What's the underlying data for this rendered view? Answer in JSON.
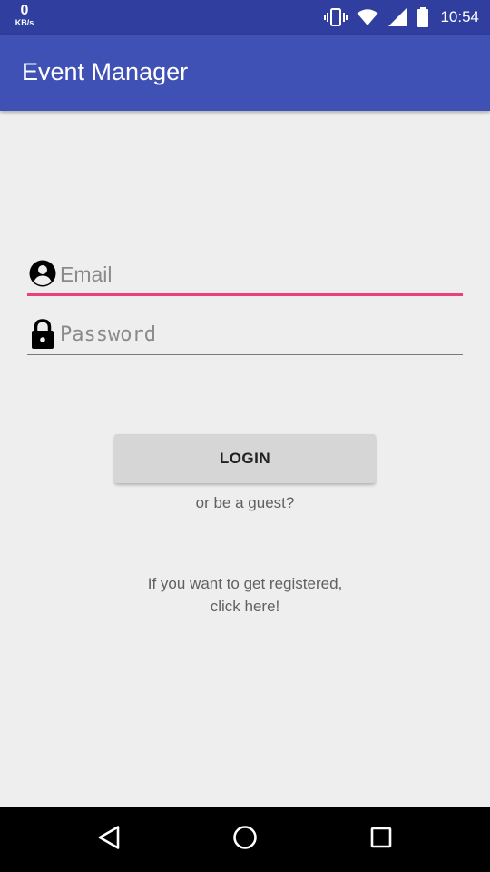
{
  "status_bar": {
    "net_speed_value": "0",
    "net_speed_unit": "KB/s",
    "time": "10:54",
    "icons": [
      "vibrate-icon",
      "wifi-icon",
      "signal-icon",
      "battery-icon"
    ]
  },
  "app_bar": {
    "title": "Event Manager"
  },
  "login_form": {
    "email_placeholder": "Email",
    "email_value": "",
    "email_icon": "account-circle-icon",
    "password_placeholder": "Password",
    "password_value": "",
    "password_icon": "lock-icon",
    "login_label": "LOGIN",
    "guest_link": "or be a guest?",
    "register_line1": "If you want to get registered,",
    "register_line2": "click here!"
  },
  "nav_bar": {
    "icons": [
      "back-icon",
      "home-icon",
      "recents-icon"
    ]
  },
  "colors": {
    "status_bar": "#303f9f",
    "app_bar": "#3f51b5",
    "accent": "#ec407a",
    "background": "#eeeeee",
    "button": "#d6d6d6"
  }
}
